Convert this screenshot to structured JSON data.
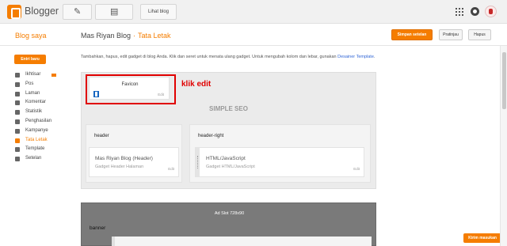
{
  "topbar": {
    "brand": "Blogger",
    "icons": {
      "pencil": "pencil-icon",
      "pages": "pages-icon",
      "apps": "apps-grid-icon",
      "notifications": "notification-icon",
      "avatar": "user-avatar"
    },
    "view_blog": "Lihat blog"
  },
  "header": {
    "blog_saya": "Blog saya",
    "blog_name": "Mas Riyan Blog",
    "separator": "·",
    "current_page": "Tata Letak",
    "save_label": "Simpan setelan",
    "preview_label": "Pratinjau",
    "delete_label": "Hapus"
  },
  "sidebar": {
    "new_post": "Entri baru",
    "items": [
      {
        "label": "Ikhtisar",
        "icon": "home-icon"
      },
      {
        "label": "Pos",
        "icon": "posts-icon"
      },
      {
        "label": "Laman",
        "icon": "pages-icon"
      },
      {
        "label": "Komentar",
        "icon": "comments-icon"
      },
      {
        "label": "Statistik",
        "icon": "stats-icon"
      },
      {
        "label": "Penghasilan",
        "icon": "earnings-icon"
      },
      {
        "label": "Kampanye",
        "icon": "campaigns-icon"
      },
      {
        "label": "Tata Letak",
        "icon": "layout-icon"
      },
      {
        "label": "Template",
        "icon": "template-icon"
      },
      {
        "label": "Setelan",
        "icon": "settings-icon"
      }
    ],
    "active_index": 7
  },
  "main": {
    "description": "Tambahkan, hapus, edit gadget di blog Anda. Klik dan seret untuk menata ulang gadget. Untuk mengubah kolom dan lebar, gunakan",
    "designer_link": "Desainer Template",
    "designer_suffix": ".",
    "favicon_gadget": {
      "title": "Favicon",
      "edit": "Edit"
    },
    "annotation": "klik edit",
    "blog_title": "SIMPLE SEO",
    "sections": [
      {
        "title": "header",
        "gadget_title": "Mas Riyan Blog (Header)",
        "gadget_sub": "Gadget Header Halaman",
        "edit": "Edit"
      },
      {
        "title": "header-right",
        "gadget_title": "HTML/JavaScript",
        "gadget_sub": "Gadget HTML/JavaScript",
        "edit": "Edit"
      }
    ],
    "ad_slot": "Ad Slot 728x90",
    "banner": "banner"
  },
  "feedback": "Kirim masukan",
  "colors": {
    "accent": "#f57d00",
    "annotation": "#e00000",
    "link": "#3367d6"
  }
}
